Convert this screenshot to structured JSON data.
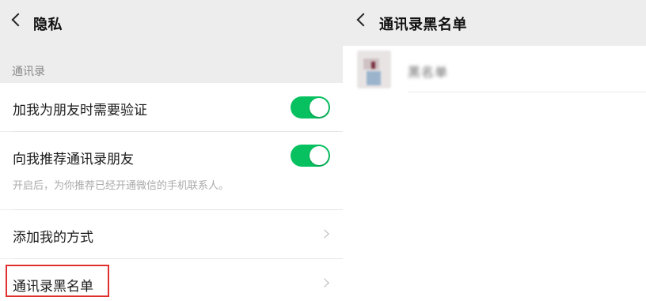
{
  "colors": {
    "background": "#ededed",
    "cell_background": "#ffffff",
    "toggle_on": "#07c160",
    "highlight_border": "#e0302e"
  },
  "privacy": {
    "title": "隐私",
    "section_label": "通讯录",
    "verify_friend": {
      "label": "加我为朋友时需要验证",
      "enabled": true
    },
    "recommend_contacts": {
      "label": "向我推荐通讯录朋友",
      "description": "开启后，为你推荐已经开通微信的手机联系人。",
      "enabled": true
    },
    "add_me_methods": {
      "label": "添加我的方式",
      "icon": "chevron-right-icon"
    },
    "contacts_blacklist": {
      "label": "通讯录黑名单",
      "icon": "chevron-right-icon"
    }
  },
  "blacklist": {
    "title": "通讯录黑名单",
    "contacts": [
      {
        "name": "黑名单",
        "avatar": "avatar-image"
      }
    ]
  }
}
